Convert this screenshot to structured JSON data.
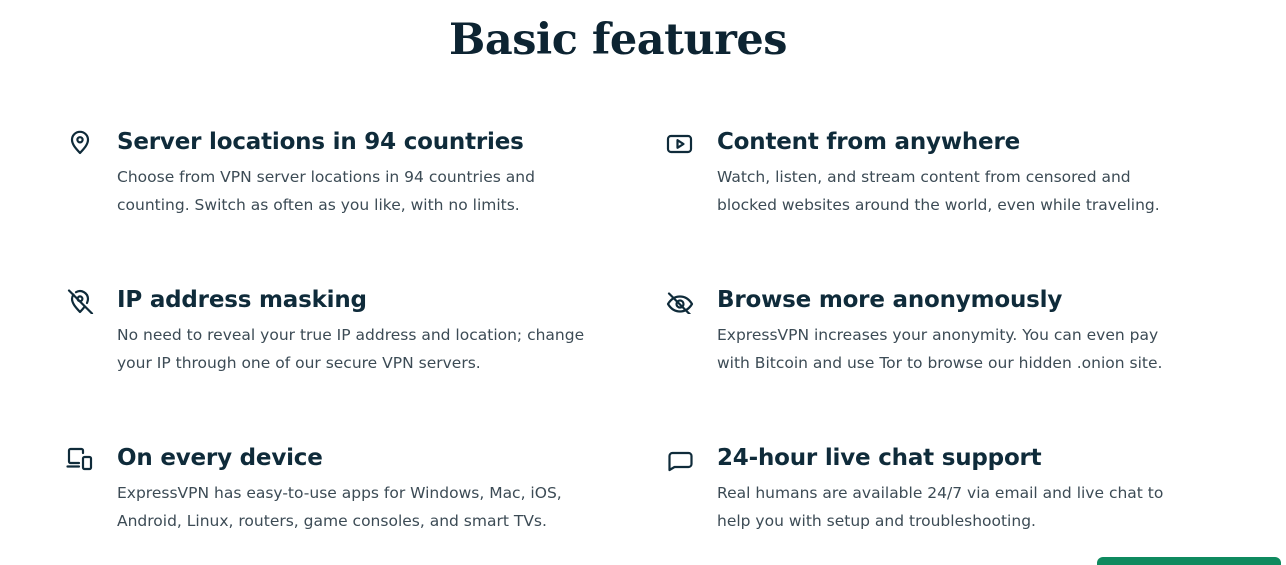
{
  "page": {
    "title": "Basic features"
  },
  "features": [
    {
      "icon": "location-pin-icon",
      "title": "Server locations in 94 countries",
      "description": "Choose from VPN server locations in 94 countries and counting. Switch as often as you like, with no limits."
    },
    {
      "icon": "play-video-icon",
      "title": "Content from anywhere",
      "description": "Watch, listen, and stream content from censored and blocked websites around the world, even while traveling."
    },
    {
      "icon": "location-off-icon",
      "title": "IP address masking",
      "description": "No need to reveal your true IP address and location; change your IP through one of our secure VPN servers."
    },
    {
      "icon": "eye-off-icon",
      "title": "Browse more anonymously",
      "description": "ExpressVPN increases your anonymity. You can even pay with Bitcoin and use Tor to browse our hidden .onion site."
    },
    {
      "icon": "devices-icon",
      "title": "On every device",
      "description": "ExpressVPN has easy-to-use apps for Windows, Mac, iOS, Android, Linux, routers, game consoles, and smart TVs."
    },
    {
      "icon": "chat-bubble-icon",
      "title": "24-hour live chat support",
      "description": "Real humans are available 24/7 via email and live chat to help you with setup and troubleshooting."
    }
  ],
  "colors": {
    "heading": "#0d2432",
    "text": "#3c4b55",
    "accent": "#0f8a5f"
  }
}
